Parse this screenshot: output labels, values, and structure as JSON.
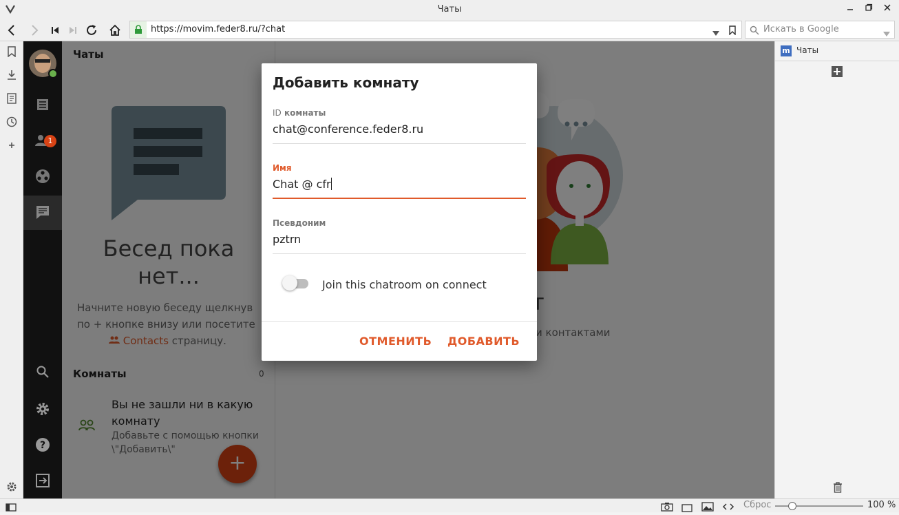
{
  "window": {
    "title": "Чаты"
  },
  "browser": {
    "url": "https://movim.feder8.ru/?chat",
    "search_placeholder": "Искать в Google",
    "zoom_reset": "Сброс",
    "zoom_level": "100 %"
  },
  "webpanel": {
    "tab_title": "Чаты",
    "tab_favicon": "m"
  },
  "appnav": {
    "contacts_badge": "1"
  },
  "chats": {
    "header": "Чаты",
    "empty_title_line1": "Бесед пока",
    "empty_title_line2": "нет...",
    "empty_desc_line1": "Начните новую беседу щелкнув",
    "empty_desc_line2": "по + кнопке внизу или посетите",
    "empty_link": "Contacts",
    "empty_desc_line3": "страницу.",
    "rooms_header": "Комнаты",
    "rooms_count": "0",
    "rooms_empty_title_line1": "Вы не зашли ни в какую",
    "rooms_empty_title_line2": "комнату",
    "rooms_empty_desc_line1": "Добавьте с помощью кнопки",
    "rooms_empty_desc_line2": "\\\"Добавить\\\"",
    "fab_label": "+"
  },
  "content": {
    "hint_fragment": "и контактами",
    "title_fragment": "т"
  },
  "dialog": {
    "title": "Добавить комнату",
    "room_id_label_prefix": "ID",
    "room_id_label": "комнаты",
    "room_id_value": "chat@conference.feder8.ru",
    "name_label": "Имя",
    "name_value": "Chat @ cfr",
    "nickname_label": "Псевдоним",
    "nickname_value": "pztrn",
    "autojoin_label": "Join this chatroom on connect",
    "autojoin_on": false,
    "cancel_label": "ОТМЕНИТЬ",
    "add_label": "ДОБАВИТЬ"
  },
  "colors": {
    "accent": "#e05a2b",
    "fab": "#d84315",
    "dark_nav": "#111111"
  }
}
